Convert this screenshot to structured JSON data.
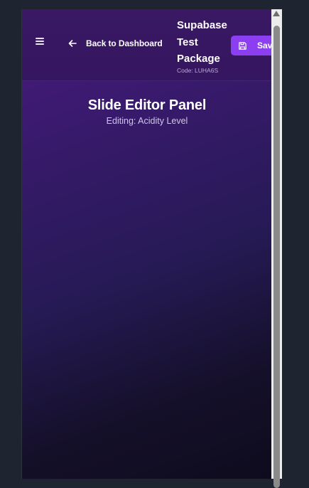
{
  "header": {
    "back_label": "Back to Dashboard",
    "package_name": "Supabase Test Package",
    "package_code": "Code: LUHA6S",
    "save_label": "Save"
  },
  "main": {
    "title": "Slide Editor Panel",
    "subtitle": "Editing: Acidity Level"
  },
  "icons": {
    "menu": "menu-icon",
    "back": "arrow-left-icon",
    "save": "floppy-disk-icon"
  },
  "colors": {
    "save_button": "#8b3ff0",
    "background_top": "#4a1a7e",
    "background_bottom": "#0e0b1d"
  }
}
